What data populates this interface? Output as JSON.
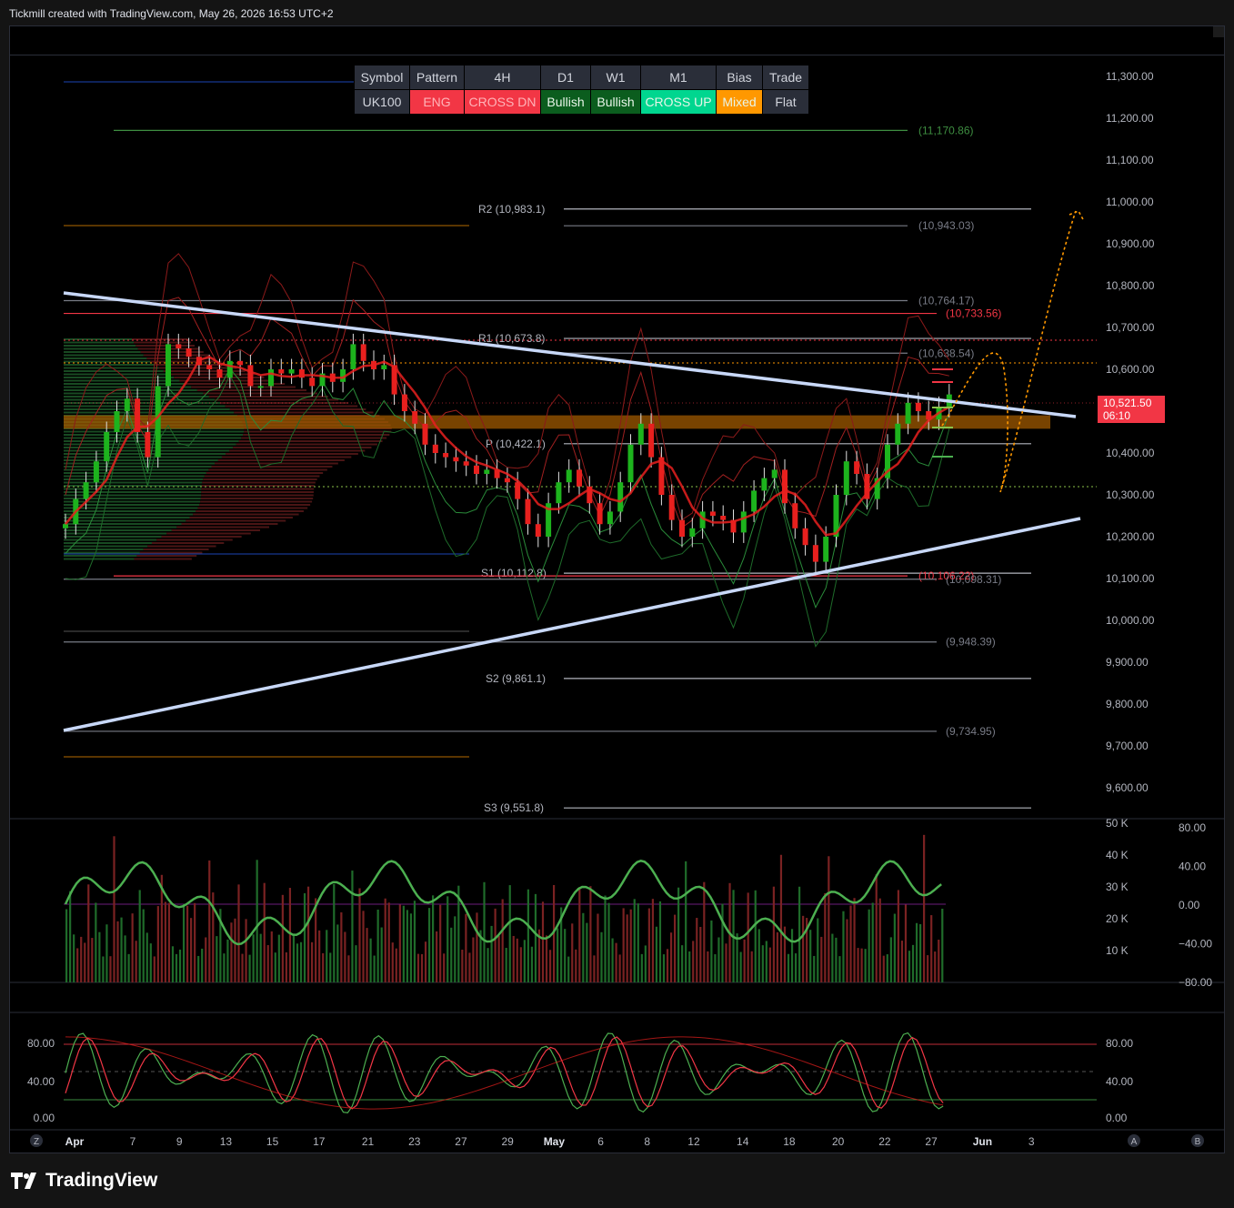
{
  "header": {
    "credit": "Tickmill created with TradingView.com, May 26, 2026 16:53 UTC+2"
  },
  "footer": {
    "logo_text": "TradingView"
  },
  "colors": {
    "bull": "#089981",
    "bear": "#f23645",
    "green_candle": "#1db31d",
    "red_candle": "#e8201e",
    "trend": "#c8d8f8",
    "mixed": "#ff9800",
    "cross_up": "#00d68f",
    "engulf": "#f23645"
  },
  "signal_table": {
    "headers": [
      "Symbol",
      "Pattern",
      "4H",
      "D1",
      "W1",
      "M1",
      "Bias",
      "Trade"
    ],
    "values": [
      "UK100",
      "ENG",
      "CROSS DN",
      "Bullish",
      "Bullish",
      "CROSS UP",
      "Mixed",
      "Flat"
    ],
    "value_colors": [
      "#2a2e39",
      "#f23645",
      "#f23645",
      "#0b5d1e",
      "#0b5d1e",
      "#00d68f",
      "#ff9800",
      "#2a2e39"
    ]
  },
  "price_tag": {
    "price": "10,521.50",
    "countdown": "06:10"
  },
  "chart_data": [
    {
      "type": "line",
      "panel": "price",
      "symbol": "UK100",
      "y_ticks": [
        "11,300.00",
        "11,200.00",
        "11,100.00",
        "11,000.00",
        "10,900.00",
        "10,800.00",
        "10,700.00",
        "10,600.00",
        "10,500.00",
        "10,400.00",
        "10,300.00",
        "10,200.00",
        "10,100.00",
        "10,000.00",
        "9,900.00",
        "9,800.00",
        "9,700.00",
        "9,600.00"
      ],
      "ylim": [
        9540,
        11340
      ],
      "x_ticks": [
        "Apr",
        "7",
        "9",
        "13",
        "15",
        "17",
        "21",
        "23",
        "27",
        "29",
        "May",
        "6",
        "8",
        "12",
        "14",
        "18",
        "20",
        "22",
        "27",
        "Jun",
        "3"
      ],
      "x_tick_idx": [
        0,
        2.5,
        4.5,
        6.5,
        8.5,
        10.5,
        12.6,
        14.6,
        16.6,
        18.6,
        20.6,
        22.6,
        24.6,
        26.6,
        28.7,
        30.7,
        32.8,
        34.8,
        36.8,
        39.0,
        41.1
      ],
      "close": [
        10230,
        10290,
        10330,
        10380,
        10450,
        10500,
        10530,
        10450,
        10390,
        10560,
        10660,
        10650,
        10630,
        10610,
        10600,
        10580,
        10620,
        10610,
        10560,
        10560,
        10600,
        10590,
        10600,
        10580,
        10560,
        10590,
        10570,
        10600,
        10660,
        10620,
        10600,
        10610,
        10540,
        10500,
        10470,
        10420,
        10400,
        10390,
        10380,
        10370,
        10350,
        10360,
        10340,
        10330,
        10290,
        10230,
        10200,
        10280,
        10330,
        10360,
        10320,
        10280,
        10230,
        10260,
        10330,
        10420,
        10470,
        10390,
        10300,
        10240,
        10200,
        10220,
        10260,
        10250,
        10240,
        10210,
        10260,
        10310,
        10340,
        10360,
        10280,
        10220,
        10180,
        10140,
        10200,
        10300,
        10380,
        10350,
        10290,
        10340,
        10420,
        10470,
        10520,
        10500,
        10480,
        10510,
        10540
      ],
      "horizontal_levels": [
        {
          "label": "(11,170.86)",
          "value": 11170.86,
          "color": "#3e8e41"
        },
        {
          "label": "R2 (10,983.1)",
          "value": 10983.1,
          "color": "#b2b5be"
        },
        {
          "label": "(10,943.03)",
          "value": 10943.03,
          "color": "#787b86"
        },
        {
          "label": "(10,764.17)",
          "value": 10764.17,
          "color": "#787b86"
        },
        {
          "label": "(10,733.56)",
          "value": 10733.56,
          "color": "#f23645"
        },
        {
          "label": "R1 (10,673.8)",
          "value": 10673.8,
          "color": "#b2b5be"
        },
        {
          "label": "(10,638.54)",
          "value": 10638.54,
          "color": "#787b86"
        },
        {
          "label": "P (10,422.1)",
          "value": 10422.1,
          "color": "#b2b5be"
        },
        {
          "label": "S1 (10,112.8)",
          "value": 10112.8,
          "color": "#b2b5be"
        },
        {
          "label": "(10,106.22)",
          "value": 10106.22,
          "color": "#f23645"
        },
        {
          "label": "(10,098.31)",
          "value": 10098.31,
          "color": "#787b86"
        },
        {
          "label": "(9,948.39)",
          "value": 9948.39,
          "color": "#787b86"
        },
        {
          "label": "S2 (9,861.1)",
          "value": 9861.1,
          "color": "#b2b5be"
        },
        {
          "label": "(9,734.95)",
          "value": 9734.95,
          "color": "#787b86"
        },
        {
          "label": "S3 (9,551.8)",
          "value": 9551.8,
          "color": "#b2b5be"
        }
      ],
      "zone": {
        "from": 10458,
        "to": 10490,
        "color": "#a05a00"
      },
      "trendlines": [
        {
          "from": [
            0,
            10785
          ],
          "to": [
            42.5,
            10486
          ]
        },
        {
          "from": [
            0,
            9740
          ],
          "to": [
            42.5,
            10247
          ]
        }
      ],
      "projection": [
        [
          36.8,
          10520
        ],
        [
          38.8,
          10635
        ],
        [
          40.0,
          10305
        ],
        [
          41.6,
          10970
        ]
      ]
    },
    {
      "type": "bar",
      "panel": "volume",
      "y_ticks_left": [
        "50 K",
        "40 K",
        "30 K",
        "20 K",
        "10 K"
      ],
      "y_ticks_right": [
        "80.00",
        "40.00",
        "0.00",
        "−40.00",
        "−80.00"
      ],
      "ylim": [
        0,
        50000
      ],
      "oscillator_ylim": [
        -80,
        80
      ]
    },
    {
      "type": "line",
      "panel": "stochastic",
      "y_ticks_left": [
        "80.00",
        "40.00",
        "0.00"
      ],
      "y_ticks_right": [
        "80.00",
        "40.00",
        "0.00"
      ],
      "ylim": [
        0,
        100
      ],
      "levels": [
        80,
        20
      ]
    }
  ],
  "x_axis_buttons": [
    "Z",
    "A",
    "B"
  ]
}
